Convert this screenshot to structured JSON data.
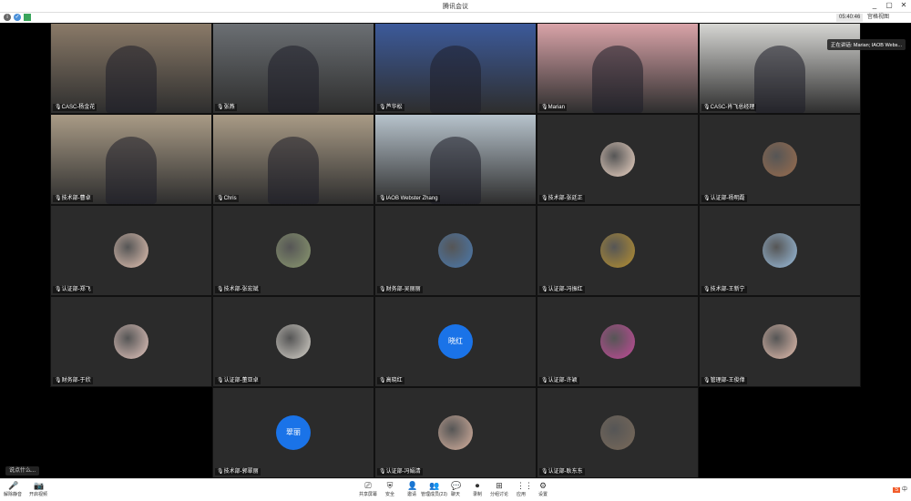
{
  "window": {
    "title": "腾讯会议",
    "controls": [
      "_",
      "▢",
      "✕"
    ]
  },
  "infobar": {
    "clock": "05:40:46",
    "view_label": "宫格视图"
  },
  "speaker_banner": "正在讲话: Marian; IAOB Webs...",
  "chat_pill": "说点什么...",
  "tiles": [
    {
      "name": "CASC-杨金花",
      "kind": "video",
      "bg": "#8a7a68"
    },
    {
      "name": "张燕",
      "kind": "video",
      "bg": "#6b6f73"
    },
    {
      "name": "芦华松",
      "kind": "video",
      "bg": "#3c5a9a"
    },
    {
      "name": "Marian",
      "kind": "video",
      "bg": "#d9a3a8"
    },
    {
      "name": "CASC-肖飞总经理",
      "kind": "video",
      "bg": "#d6d6d3"
    },
    {
      "name": "技术部-曹卓",
      "kind": "video",
      "bg": "#a99b86"
    },
    {
      "name": "Chris",
      "kind": "video",
      "bg": "#a99b86"
    },
    {
      "name": "IAOB Webster Zhang",
      "kind": "video",
      "bg": "#b7c3cc"
    },
    {
      "name": "技术部-张廷正",
      "kind": "avatar",
      "avatar_bg": "#f0d7c7"
    },
    {
      "name": "认证部-杨明磊",
      "kind": "avatar",
      "avatar_bg": "#9b6d4d"
    },
    {
      "name": "认证部-郑飞",
      "kind": "avatar",
      "avatar_bg": "#e6c5b5"
    },
    {
      "name": "技术部-张宏斌",
      "kind": "avatar",
      "avatar_bg": "#8c9a70"
    },
    {
      "name": "财务部-吴丽丽",
      "kind": "avatar",
      "avatar_bg": "#4a7ab0"
    },
    {
      "name": "认证部-冯振红",
      "kind": "avatar",
      "avatar_bg": "#b8912f"
    },
    {
      "name": "技术部-王新宁",
      "kind": "avatar",
      "avatar_bg": "#9cc0e0"
    },
    {
      "name": "财务部-于欣",
      "kind": "avatar",
      "avatar_bg": "#e7c8c0"
    },
    {
      "name": "认证部-董亚卓",
      "kind": "avatar",
      "avatar_bg": "#d8d4cc"
    },
    {
      "name": "高晓红",
      "kind": "text",
      "avatar_text": "晓红"
    },
    {
      "name": "认证部-许颖",
      "kind": "avatar",
      "avatar_bg": "#c44a9a"
    },
    {
      "name": "管理部-王俊偉",
      "kind": "avatar",
      "avatar_bg": "#e7c0b0"
    },
    {
      "name": "技术部-郭翠丽",
      "kind": "text",
      "avatar_text": "翠丽"
    },
    {
      "name": "认证部-冯娟清",
      "kind": "avatar",
      "avatar_bg": "#d9b3a0"
    },
    {
      "name": "认证部-耿东东",
      "kind": "avatar",
      "avatar_bg": "#7a6a5a"
    }
  ],
  "toolbar": {
    "left": [
      {
        "label": "解除静音",
        "icon": "mic-muted-icon"
      },
      {
        "label": "开启视频",
        "icon": "camera-off-icon"
      }
    ],
    "center": [
      {
        "label": "共享屏幕",
        "icon": "share-screen-icon"
      },
      {
        "label": "安全",
        "icon": "shield-icon"
      },
      {
        "label": "邀请",
        "icon": "invite-icon"
      },
      {
        "label": "管理成员(23)",
        "icon": "members-icon"
      },
      {
        "label": "聊天",
        "icon": "chat-icon"
      },
      {
        "label": "录制",
        "icon": "record-icon"
      },
      {
        "label": "分组讨论",
        "icon": "breakout-icon"
      },
      {
        "label": "应用",
        "icon": "apps-icon"
      },
      {
        "label": "设置",
        "icon": "settings-icon"
      }
    ]
  },
  "tray": {
    "ime": "S",
    "ime_label": "中"
  }
}
